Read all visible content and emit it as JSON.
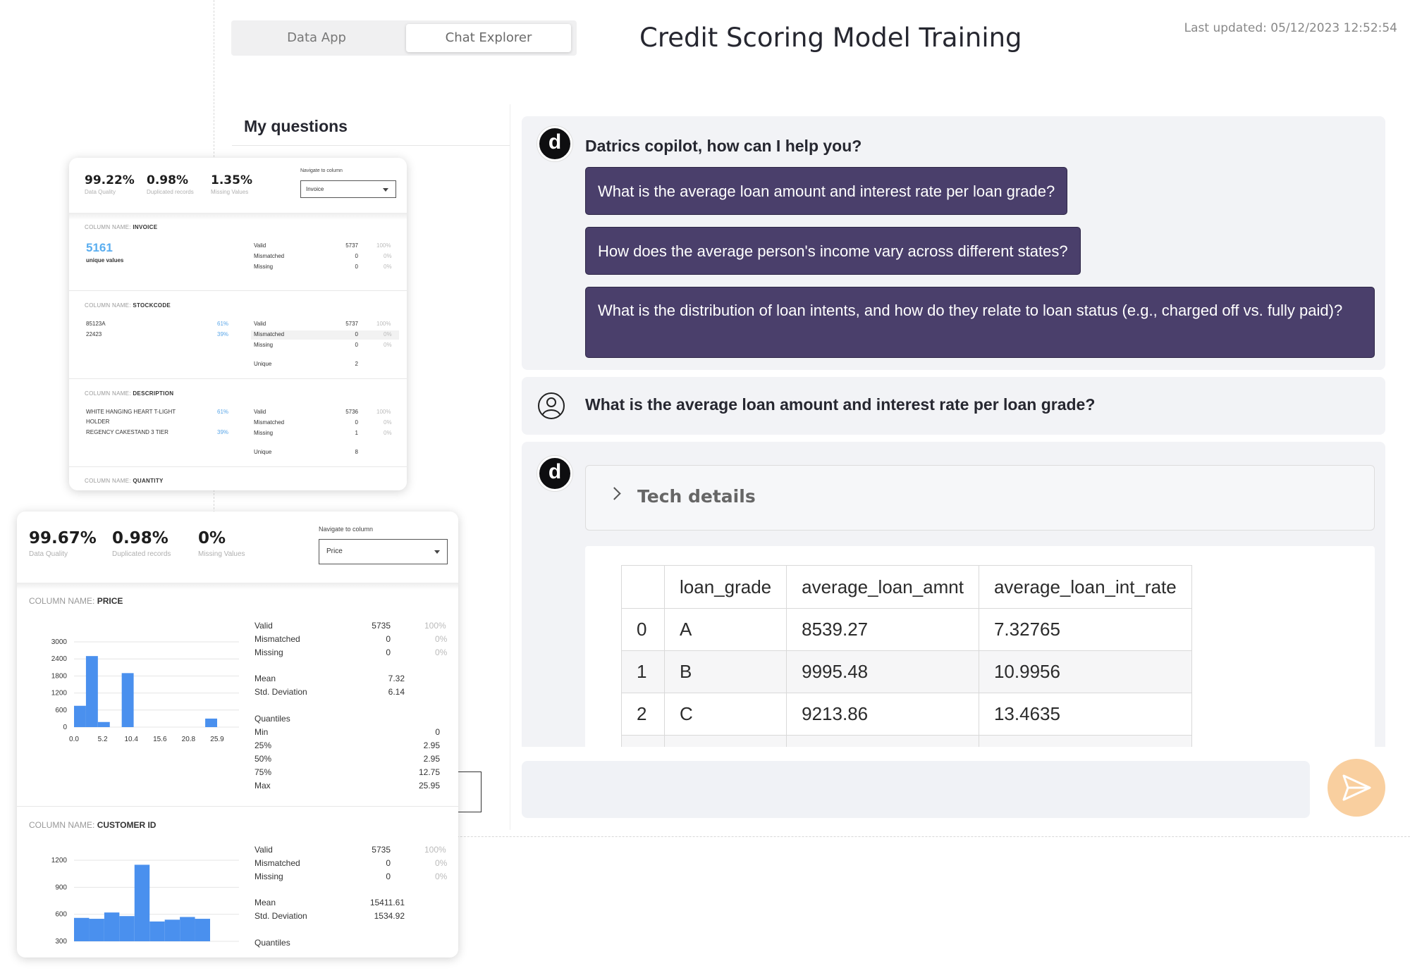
{
  "app": {
    "tabs": [
      {
        "label": "Data App"
      },
      {
        "label": "Chat Explorer"
      }
    ],
    "title": "Credit Scoring Model Training",
    "last_updated": "Last updated: 05/12/2023 12:52:54"
  },
  "left_panel": {
    "heading": "My questions"
  },
  "chat": {
    "greeting": "Datrics copilot, how can I help you?",
    "suggestions": [
      "What is the average loan amount and interest rate per loan grade?",
      "How does the average person's income vary across different states?",
      "What is the distribution of loan intents, and how do they relate to loan status (e.g., charged off vs. fully paid)?"
    ],
    "user_question": "What is the average loan amount and interest rate per loan grade?",
    "tech_details_label": "Tech details",
    "result_table": {
      "columns": [
        "",
        "loan_grade",
        "average_loan_amnt",
        "average_loan_int_rate"
      ],
      "rows": [
        [
          "0",
          "A",
          "8539.27",
          "7.32765"
        ],
        [
          "1",
          "B",
          "9995.48",
          "10.9956"
        ],
        [
          "2",
          "C",
          "9213.86",
          "13.4635"
        ]
      ]
    },
    "avatar_letter": "d",
    "input_value": ""
  },
  "card_a": {
    "stats": [
      {
        "value": "99.22%",
        "label": "Data Quality"
      },
      {
        "value": "0.98%",
        "label": "Duplicated records"
      },
      {
        "value": "1.35%",
        "label": "Missing Values"
      }
    ],
    "navigate_label": "Navigate to column",
    "navigate_value": "Invoice",
    "col_prefix": "COLUMN NAME:",
    "invoice": {
      "name": "INVOICE",
      "unique_count": "5161",
      "unique_label": "unique values",
      "rows": [
        [
          "Valid",
          "5737",
          "100%"
        ],
        [
          "Mismatched",
          "0",
          "0%"
        ],
        [
          "Missing",
          "0",
          "0%"
        ]
      ]
    },
    "stockcode": {
      "name": "STOCKCODE",
      "values": [
        [
          "85123A",
          "61%"
        ],
        [
          "22423",
          "39%"
        ]
      ],
      "rows": [
        [
          "Valid",
          "5737",
          "100%"
        ],
        [
          "Mismatched",
          "0",
          "0%"
        ],
        [
          "Missing",
          "0",
          "0%"
        ]
      ],
      "unique_label": "Unique",
      "unique_count": "2"
    },
    "description": {
      "name": "DESCRIPTION",
      "values": [
        [
          "WHITE HANGING HEART T-LIGHT",
          "61%"
        ],
        [
          "HOLDER",
          ""
        ],
        [
          "REGENCY CAKESTAND 3 TIER",
          "39%"
        ]
      ],
      "rows": [
        [
          "Valid",
          "5736",
          "100%"
        ],
        [
          "Mismatched",
          "0",
          "0%"
        ],
        [
          "Missing",
          "1",
          "0%"
        ]
      ],
      "unique_label": "Unique",
      "unique_count": "8"
    },
    "quantity": {
      "name": "QUANTITY"
    }
  },
  "card_b": {
    "stats": [
      {
        "value": "99.67%",
        "label": "Data Quality"
      },
      {
        "value": "0.98%",
        "label": "Duplicated records"
      },
      {
        "value": "0%",
        "label": "Missing Values"
      }
    ],
    "navigate_label": "Navigate to column",
    "navigate_value": "Price",
    "col_prefix": "COLUMN NAME:",
    "price": {
      "name": "PRICE",
      "rows": [
        [
          "Valid",
          "5735",
          "100%"
        ],
        [
          "Mismatched",
          "0",
          "0%"
        ],
        [
          "Missing",
          "0",
          "0%"
        ]
      ],
      "mean": [
        "Mean",
        "7.32"
      ],
      "std": [
        "Std. Deviation",
        "6.14"
      ],
      "quantiles_label": "Quantiles",
      "quantiles": [
        [
          "Min",
          "0"
        ],
        [
          "25%",
          "2.95"
        ],
        [
          "50%",
          "2.95"
        ],
        [
          "75%",
          "12.75"
        ],
        [
          "Max",
          "25.95"
        ]
      ]
    },
    "customer": {
      "name": "CUSTOMER ID",
      "rows": [
        [
          "Valid",
          "5735",
          "100%"
        ],
        [
          "Mismatched",
          "0",
          "0%"
        ],
        [
          "Missing",
          "0",
          "0%"
        ]
      ],
      "mean": [
        "Mean",
        "15411.61"
      ],
      "std": [
        "Std. Deviation",
        "1534.92"
      ],
      "quantiles_label": "Quantiles"
    }
  },
  "chart_data": [
    {
      "type": "bar",
      "x_ticks": [
        "0.0",
        "5.2",
        "10.4",
        "15.6",
        "20.8",
        "25.9"
      ],
      "y_ticks": [
        "0",
        "600",
        "1200",
        "1800",
        "2400",
        "3000"
      ],
      "ylim": [
        0,
        3000
      ],
      "values": [
        750,
        2500,
        180,
        0,
        1900,
        0,
        0,
        0,
        0,
        0,
        0,
        300
      ],
      "color": "#4a90ee"
    },
    {
      "type": "bar",
      "y_ticks": [
        "300",
        "600",
        "900",
        "1200"
      ],
      "ylim": [
        300,
        1200
      ],
      "values": [
        560,
        550,
        620,
        580,
        1150,
        520,
        540,
        570,
        550
      ],
      "color": "#4a90ee"
    }
  ]
}
